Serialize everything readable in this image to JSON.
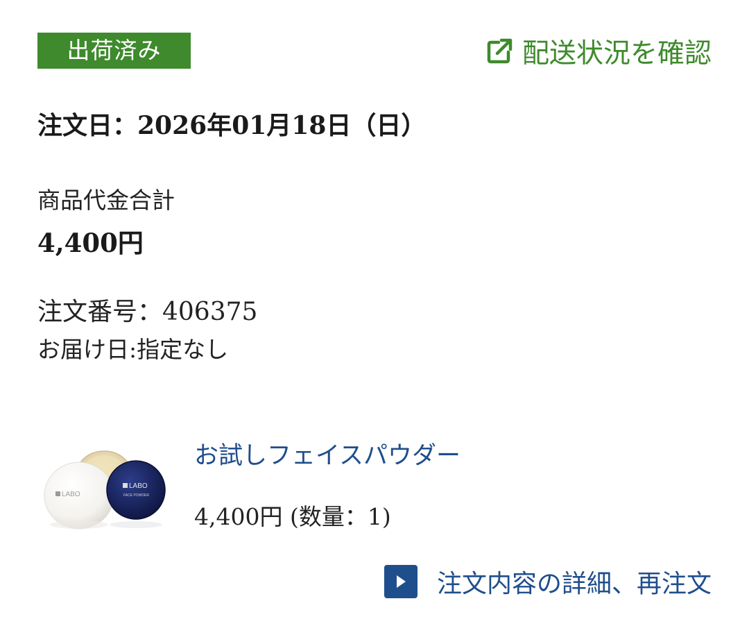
{
  "status": {
    "badge_label": "出荷済み",
    "badge_color": "#3e8a2c"
  },
  "tracking": {
    "label": "配送状況を確認",
    "icon": "external-link-icon"
  },
  "order": {
    "date_text": "注文日：2026年01月18日（日）",
    "subtotal_label": "商品代金合計",
    "subtotal_value": "4,400円",
    "number_text": "注文番号：406375",
    "delivery_text": "お届け日:指定なし"
  },
  "product": {
    "name": "お試しフェイスパウダー",
    "price_text": "4,400円 (数量：1)",
    "image_brand": "LABO",
    "image_sub": "FACE POWDER"
  },
  "detail_link": {
    "label": "注文内容の詳細、再注文",
    "icon": "play-icon"
  },
  "colors": {
    "accent_green": "#3e8a2c",
    "link_blue": "#1f4e8c"
  }
}
